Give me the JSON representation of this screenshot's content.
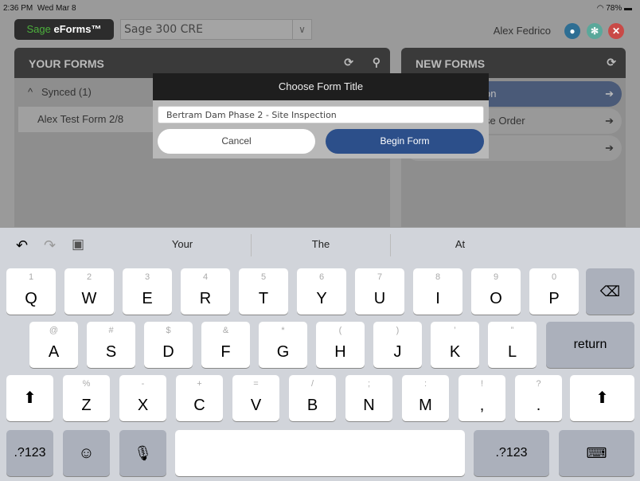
{
  "status": {
    "time": "2:36 PM",
    "date": "Wed Mar 8",
    "battery": "78%"
  },
  "app": {
    "logo_brand": "Sage",
    "logo_product": "eForms™",
    "company": "Sage 300 CRE",
    "user": "Alex Fedrico"
  },
  "your_forms": {
    "title": "YOUR FORMS",
    "group": "Synced (1)",
    "items": [
      "Alex Test Form 2/8"
    ]
  },
  "new_forms": {
    "title": "NEW FORMS",
    "items": [
      "on",
      "se Order",
      ""
    ]
  },
  "dialog": {
    "title": "Choose Form Title",
    "value": "Bertram Dam Phase 2 - Site Inspection",
    "cancel": "Cancel",
    "begin": "Begin Form"
  },
  "keyboard": {
    "suggestions": [
      "Your",
      "The",
      "At"
    ],
    "rows": [
      [
        [
          "1",
          "Q"
        ],
        [
          "2",
          "W"
        ],
        [
          "3",
          "E"
        ],
        [
          "4",
          "R"
        ],
        [
          "5",
          "T"
        ],
        [
          "6",
          "Y"
        ],
        [
          "7",
          "U"
        ],
        [
          "8",
          "I"
        ],
        [
          "9",
          "O"
        ],
        [
          "0",
          "P"
        ]
      ],
      [
        [
          "@",
          "A"
        ],
        [
          "#",
          "S"
        ],
        [
          "$",
          "D"
        ],
        [
          "&",
          "F"
        ],
        [
          "*",
          "G"
        ],
        [
          "(",
          "H"
        ],
        [
          ")",
          "J"
        ],
        [
          "’",
          "K"
        ],
        [
          "”",
          "L"
        ]
      ],
      [
        [
          "%",
          "Z"
        ],
        [
          "-",
          "X"
        ],
        [
          "+",
          "C"
        ],
        [
          "=",
          "V"
        ],
        [
          "/",
          "B"
        ],
        [
          ";",
          "N"
        ],
        [
          ":",
          "M"
        ],
        [
          "!",
          ","
        ],
        [
          "?",
          "."
        ]
      ]
    ],
    "return": "return",
    "numbers": ".?123"
  },
  "colors": {
    "accent": "#2c4f8a",
    "danger": "#d9534f",
    "teal": "#5aa89a",
    "user_blue": "#2e6e93"
  }
}
